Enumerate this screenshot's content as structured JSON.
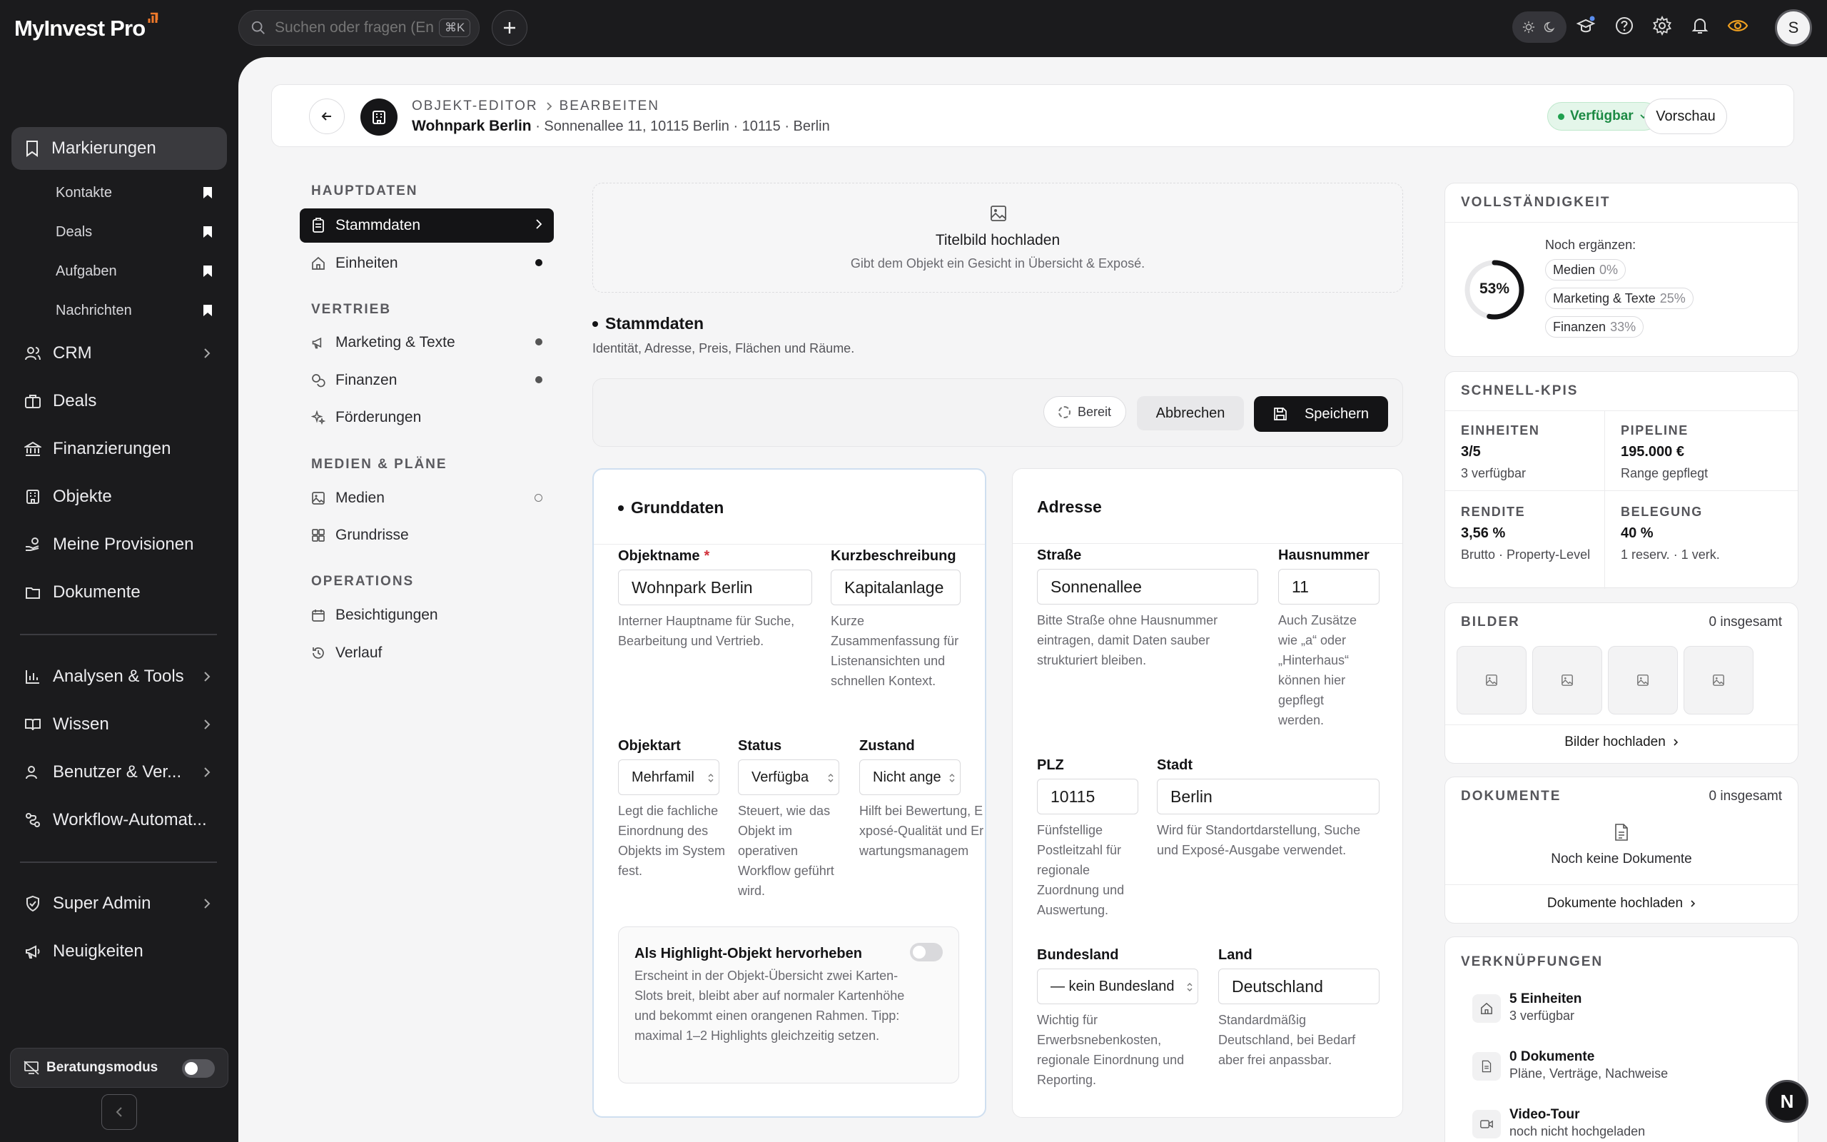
{
  "app": {
    "brand": "MyInvest Pro"
  },
  "topbar": {
    "search_placeholder": "Suchen oder fragen (Enter)",
    "search_shortcut": "⌘K",
    "avatar_initial": "S"
  },
  "sidebar": {
    "markierungen": "Markierungen",
    "sub_items": [
      "Kontakte",
      "Deals",
      "Aufgaben",
      "Nachrichten"
    ],
    "items": [
      "CRM",
      "Deals",
      "Finanzierungen",
      "Objekte",
      "Meine Provisionen",
      "Dokumente"
    ],
    "items2": [
      "Analysen & Tools",
      "Wissen",
      "Benutzer & Ver...",
      "Workflow-Automat..."
    ],
    "items3": [
      "Super Admin",
      "Neuigkeiten"
    ],
    "beratungsmodus": "Beratungsmodus"
  },
  "header": {
    "crumb1": "OBJEKT-EDITOR",
    "crumb2": "BEARBEITEN",
    "title": "Wohnpark Berlin",
    "subtitle": "· Sonnenallee 11, 10115 Berlin · 10115 · Berlin",
    "status": "Verfügbar",
    "preview": "Vorschau"
  },
  "secnav": {
    "groups": [
      "HAUPTDATEN",
      "VERTRIEB",
      "MEDIEN & PLÄNE",
      "OPERATIONS"
    ],
    "items": [
      "Stammdaten",
      "Einheiten",
      "Marketing & Texte",
      "Finanzen",
      "Förderungen",
      "Medien",
      "Grundrisse",
      "Besichtigungen",
      "Verlauf"
    ]
  },
  "upload": {
    "title": "Titelbild hochladen",
    "desc": "Gibt dem Objekt ein Gesicht in Übersicht & Exposé."
  },
  "section": {
    "title": "Stammdaten",
    "desc": "Identität, Adresse, Preis, Flächen und Räume."
  },
  "actions": {
    "ready": "Bereit",
    "cancel": "Abbrechen",
    "save": "Speichern"
  },
  "grunddaten": {
    "title": "Grunddaten",
    "name_label": "Objektname",
    "name_req": "*",
    "name_value": "Wohnpark Berlin",
    "name_help": "Interner Hauptname für Suche, Bearbeitung und Vertrieb.",
    "short_label": "Kurzbeschreibung",
    "short_value": "Kapitalanlage",
    "short_help": "Kurze Zusammenfassung für Listenansichten und schnellen Kontext.",
    "type_label": "Objektart",
    "type_value": "Mehrfamil",
    "type_help": "Legt die fachliche Einordnung des Objekts im System fest.",
    "status_label": "Status",
    "status_value": "Verfügba",
    "status_help": "Steuert, wie das Objekt im operativen Workflow geführt wird.",
    "cond_label": "Zustand",
    "cond_value": "Nicht ange",
    "cond_help": "Hilft bei Bewertung, Exposé-Qualität und Erwartungsmanagem",
    "highlight_title": "Als Highlight-Objekt hervorheben",
    "highlight_desc": "Erscheint in der Objekt-Übersicht zwei Karten-Slots breit, bleibt aber auf normaler Kartenhöhe und bekommt einen orangenen Rahmen. Tipp: maximal 1–2 Highlights gleichzeitig setzen."
  },
  "adresse": {
    "title": "Adresse",
    "street_label": "Straße",
    "street_value": "Sonnenallee",
    "street_help": "Bitte Straße ohne Hausnummer eintragen, damit Daten sauber strukturiert bleiben.",
    "no_label": "Hausnummer",
    "no_value": "11",
    "no_help": "Auch Zusätze wie „a“ oder „Hinterhaus“ können hier gepflegt werden.",
    "zip_label": "PLZ",
    "zip_value": "10115",
    "zip_help": "Fünfstellige Postleitzahl für regionale Zuordnung und Auswertung.",
    "city_label": "Stadt",
    "city_value": "Berlin",
    "city_help": "Wird für Standortdarstellung, Suche und Exposé-Ausgabe verwendet.",
    "state_label": "Bundesland",
    "state_value": "— kein Bundesland",
    "state_help": "Wichtig für Erwerbsnebenkosten, regionale Einordnung und Reporting.",
    "country_label": "Land",
    "country_value": "Deutschland",
    "country_help": "Standardmäßig Deutschland, bei Bedarf aber frei anpassbar."
  },
  "completeness": {
    "title": "VOLLSTÄNDIGKEIT",
    "percent": 53,
    "percent_label": "53%",
    "missing_label": "Noch ergänzen:",
    "missing": [
      {
        "name": "Medien",
        "value": "0%"
      },
      {
        "name": "Marketing & Texte",
        "value": "25%"
      },
      {
        "name": "Finanzen",
        "value": "33%"
      }
    ]
  },
  "kpis": {
    "title": "SCHNELL-KPIS",
    "items": [
      {
        "label": "EINHEITEN",
        "value": "3/5",
        "sub": "3 verfügbar"
      },
      {
        "label": "PIPELINE",
        "value": "195.000 €",
        "sub": "Range gepflegt"
      },
      {
        "label": "RENDITE",
        "value": "3,56 %",
        "sub": "Brutto · Property-Level"
      },
      {
        "label": "BELEGUNG",
        "value": "40 %",
        "sub": "1 reserv. · 1 verk."
      }
    ]
  },
  "bilder": {
    "title": "BILDER",
    "count": "0 insgesamt",
    "link": "Bilder hochladen"
  },
  "dokumente": {
    "title": "DOKUMENTE",
    "count": "0 insgesamt",
    "empty": "Noch keine Dokumente",
    "link": "Dokumente hochladen"
  },
  "verknuepfungen": {
    "title": "VERKNÜPFUNGEN",
    "items": [
      {
        "title": "5 Einheiten",
        "sub": "3 verfügbar"
      },
      {
        "title": "0 Dokumente",
        "sub": "Pläne, Verträge, Nachweise"
      },
      {
        "title": "Video-Tour",
        "sub": "noch nicht hochgeladen"
      }
    ]
  },
  "fab": {
    "label": "N"
  }
}
